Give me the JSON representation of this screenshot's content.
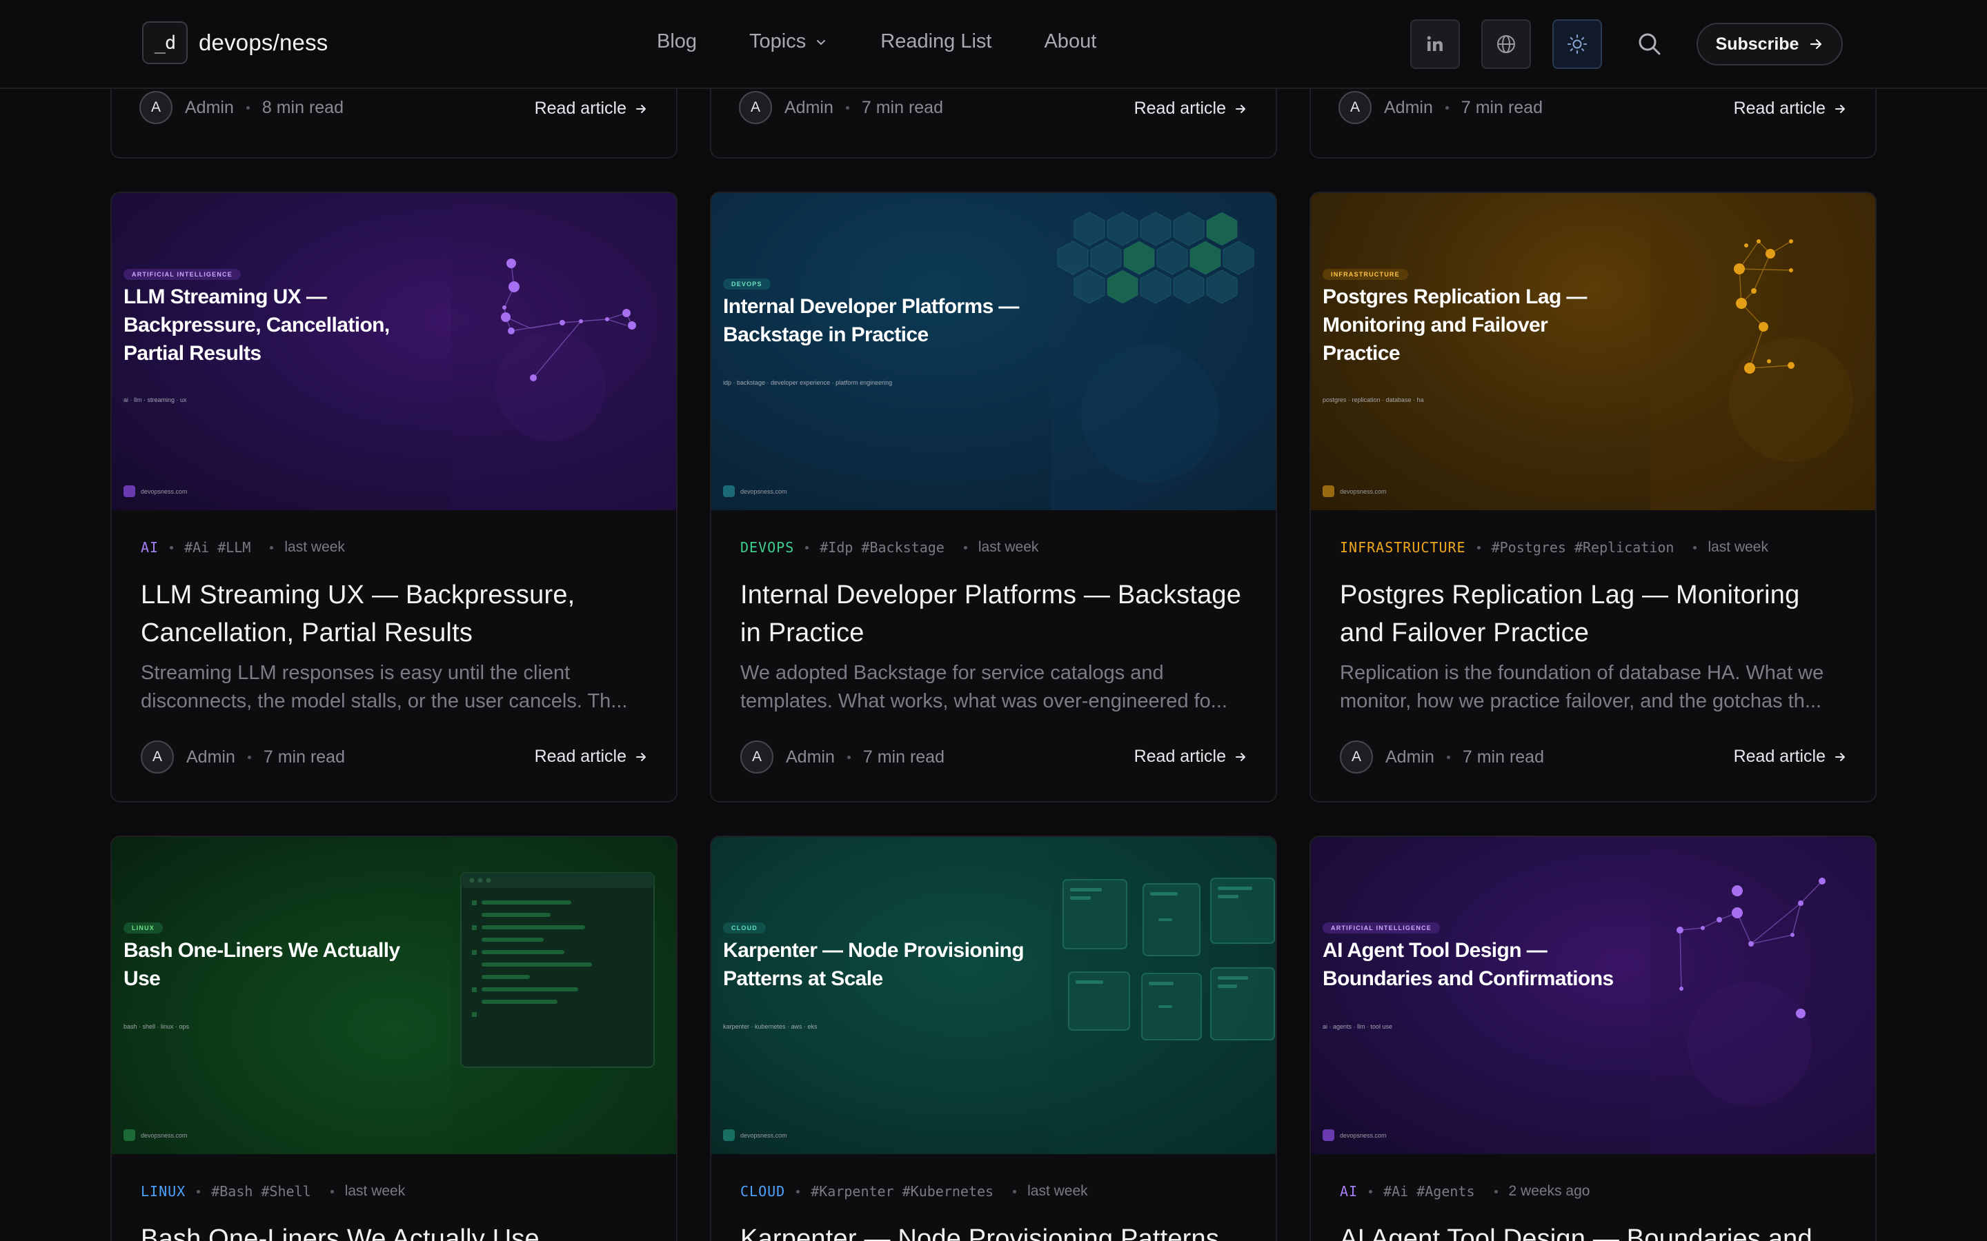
{
  "site": {
    "logo_mark": "_d",
    "name": "devops/ness"
  },
  "nav": {
    "blog": "Blog",
    "topics": "Topics",
    "reading_list": "Reading List",
    "about": "About"
  },
  "header_icons": [
    "linkedin-icon",
    "globe-icon",
    "sun-icon",
    "search-icon"
  ],
  "subscribe_label": "Subscribe",
  "top_row": [
    {
      "avatar": "A",
      "author": "Admin",
      "read_time": "8 min read",
      "cta": "Read article"
    },
    {
      "avatar": "A",
      "author": "Admin",
      "read_time": "7 min read",
      "cta": "Read article"
    },
    {
      "avatar": "A",
      "author": "Admin",
      "read_time": "7 min read",
      "cta": "Read article"
    }
  ],
  "articles": [
    {
      "cover_badge": "ARTIFICIAL INTELLIGENCE",
      "cover_title": "LLM Streaming UX — Backpressure, Cancellation, Partial Results",
      "cover_tags": "ai · llm · streaming · ux",
      "cover_domain": "devopsness.com",
      "category": "AI",
      "category_color": "#a87ef5",
      "tags": [
        "#Ai",
        "#LLM"
      ],
      "when": "last week",
      "title": "LLM Streaming UX — Backpressure, Cancellation, Partial Results",
      "excerpt": "Streaming LLM responses is easy until the client disconnects, the model stalls, or the user cancels. Th...",
      "avatar": "A",
      "author": "Admin",
      "read_time": "7 min read",
      "cta": "Read article"
    },
    {
      "cover_badge": "DEVOPS",
      "cover_title": "Internal Developer Platforms — Backstage in Practice",
      "cover_tags": "idp · backstage · developer experience · platform engineering",
      "cover_domain": "devopsness.com",
      "category": "DEVOPS",
      "category_color": "#3ecf8e",
      "tags": [
        "#Idp",
        "#Backstage"
      ],
      "when": "last week",
      "title": "Internal Developer Platforms — Backstage in Practice",
      "excerpt": "We adopted Backstage for service catalogs and templates. What works, what was over-engineered fo...",
      "avatar": "A",
      "author": "Admin",
      "read_time": "7 min read",
      "cta": "Read article"
    },
    {
      "cover_badge": "INFRASTRUCTURE",
      "cover_title": "Postgres Replication Lag — Monitoring and Failover Practice",
      "cover_tags": "postgres · replication · database · ha",
      "cover_domain": "devopsness.com",
      "category": "INFRASTRUCTURE",
      "category_color": "#f0a81c",
      "tags": [
        "#Postgres",
        "#Replication"
      ],
      "when": "last week",
      "title": "Postgres Replication Lag — Monitoring and Failover Practice",
      "excerpt": "Replication is the foundation of database HA. What we monitor, how we practice failover, and the gotchas th...",
      "avatar": "A",
      "author": "Admin",
      "read_time": "7 min read",
      "cta": "Read article"
    },
    {
      "cover_badge": "LINUX",
      "cover_title": "Bash One-Liners We Actually Use",
      "cover_tags": "bash · shell · linux · ops",
      "cover_domain": "devopsness.com",
      "category": "LINUX",
      "category_color": "#4da3ff",
      "tags": [
        "#Bash",
        "#Shell"
      ],
      "when": "last week",
      "title": "Bash One-Liners We Actually Use"
    },
    {
      "cover_badge": "CLOUD",
      "cover_title": "Karpenter — Node Provisioning Patterns at Scale",
      "cover_tags": "karpenter · kubernetes · aws · eks",
      "cover_domain": "devopsness.com",
      "category": "CLOUD",
      "category_color": "#4da3ff",
      "tags": [
        "#Karpenter",
        "#Kubernetes"
      ],
      "when": "last week",
      "title": "Karpenter — Node Provisioning Patterns at"
    },
    {
      "cover_badge": "ARTIFICIAL INTELLIGENCE",
      "cover_title": "AI Agent Tool Design — Boundaries and Confirmations",
      "cover_tags": "ai · agents · llm · tool use",
      "cover_domain": "devopsness.com",
      "category": "AI",
      "category_color": "#a87ef5",
      "tags": [
        "#Ai",
        "#Agents"
      ],
      "when": "2 weeks ago",
      "title": "AI Agent Tool Design — Boundaries and"
    }
  ]
}
